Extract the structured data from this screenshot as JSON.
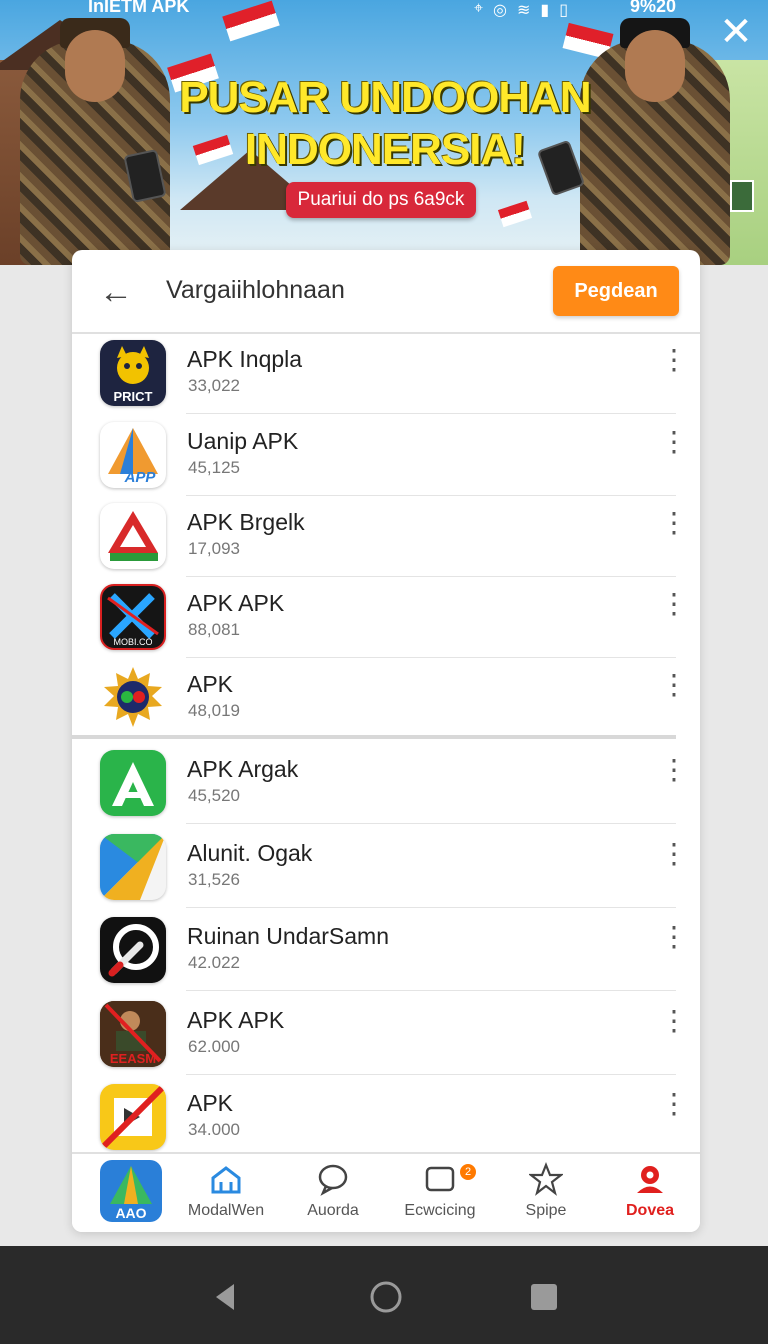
{
  "status_bar": {
    "left_text": "InIETM APK",
    "right_text": "9%20"
  },
  "banner": {
    "title": "PUSAR UNDOOHAN INDONERSIA!",
    "cta_label": "Puariui do ps 6a9ck"
  },
  "header": {
    "title": "Vargaiihlohnaan",
    "primary_button": "Pegdean"
  },
  "apps": [
    {
      "name": "APK Inqpla",
      "count": "33,022",
      "icon": "mask-icon"
    },
    {
      "name": "Uanip APK",
      "count": "45,125",
      "icon": "app-triangle-icon",
      "icon_text": "APP"
    },
    {
      "name": "APK Brgelk",
      "count": "17,093",
      "icon": "red-green-triangle-icon"
    },
    {
      "name": "APK APK",
      "count": "88,081",
      "icon": "crossed-blades-icon",
      "icon_text": "MOBI.CO"
    },
    {
      "name": "APK",
      "count": "48,019",
      "icon": "sun-emblem-icon"
    },
    {
      "name": "APK Argak",
      "count": "45,520",
      "icon": "green-a-icon"
    },
    {
      "name": "Alunit. Ogak",
      "count": "31,526",
      "icon": "play-triangle-icon"
    },
    {
      "name": "Ruinan UndarSamn",
      "count": "42.022",
      "icon": "brush-circle-icon"
    },
    {
      "name": "APK APK",
      "count": "62.000",
      "icon": "poster-icon",
      "icon_text": "EEASM"
    },
    {
      "name": "APK",
      "count": "34.000",
      "icon": "crossed-square-icon"
    }
  ],
  "bottom_nav": [
    {
      "label": "",
      "icon": "app-logo-icon",
      "icon_text": "AAO"
    },
    {
      "label": "ModalWen",
      "icon": "home-icon"
    },
    {
      "label": "Auorda",
      "icon": "chat-icon"
    },
    {
      "label": "Ecwcicing",
      "icon": "message-badge-icon",
      "badge": "2"
    },
    {
      "label": "Spipe",
      "icon": "star-icon"
    },
    {
      "label": "Dovea",
      "icon": "profile-icon",
      "active": true
    }
  ],
  "colors": {
    "accent": "#ff8a16",
    "active_nav": "#e0201e",
    "cta": "#d8283a",
    "banner_title": "#ffe82a"
  }
}
